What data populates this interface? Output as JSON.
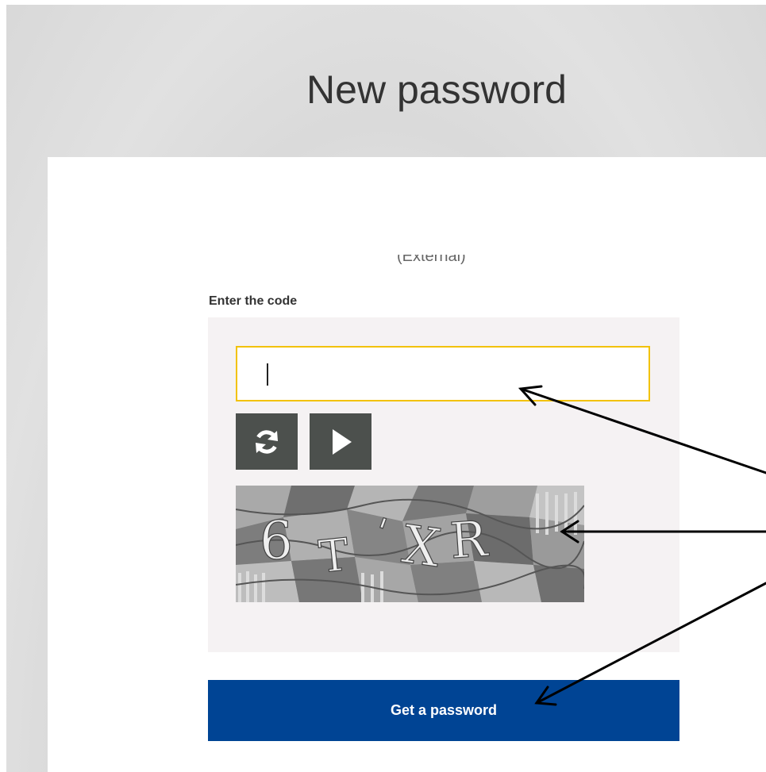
{
  "page": {
    "title": "New password"
  },
  "form": {
    "subtitle_fragment": "(External)",
    "code_label": "Enter the code",
    "code_value": "",
    "refresh_icon": "refresh-icon",
    "play_icon": "play-audio-icon",
    "captcha_text": "6T'XR",
    "submit_label": "Get a password"
  },
  "colors": {
    "input_border": "#f2c200",
    "button_bg": "#004494",
    "icon_button_bg": "#4c504d",
    "panel_bg": "#f5f2f3"
  }
}
